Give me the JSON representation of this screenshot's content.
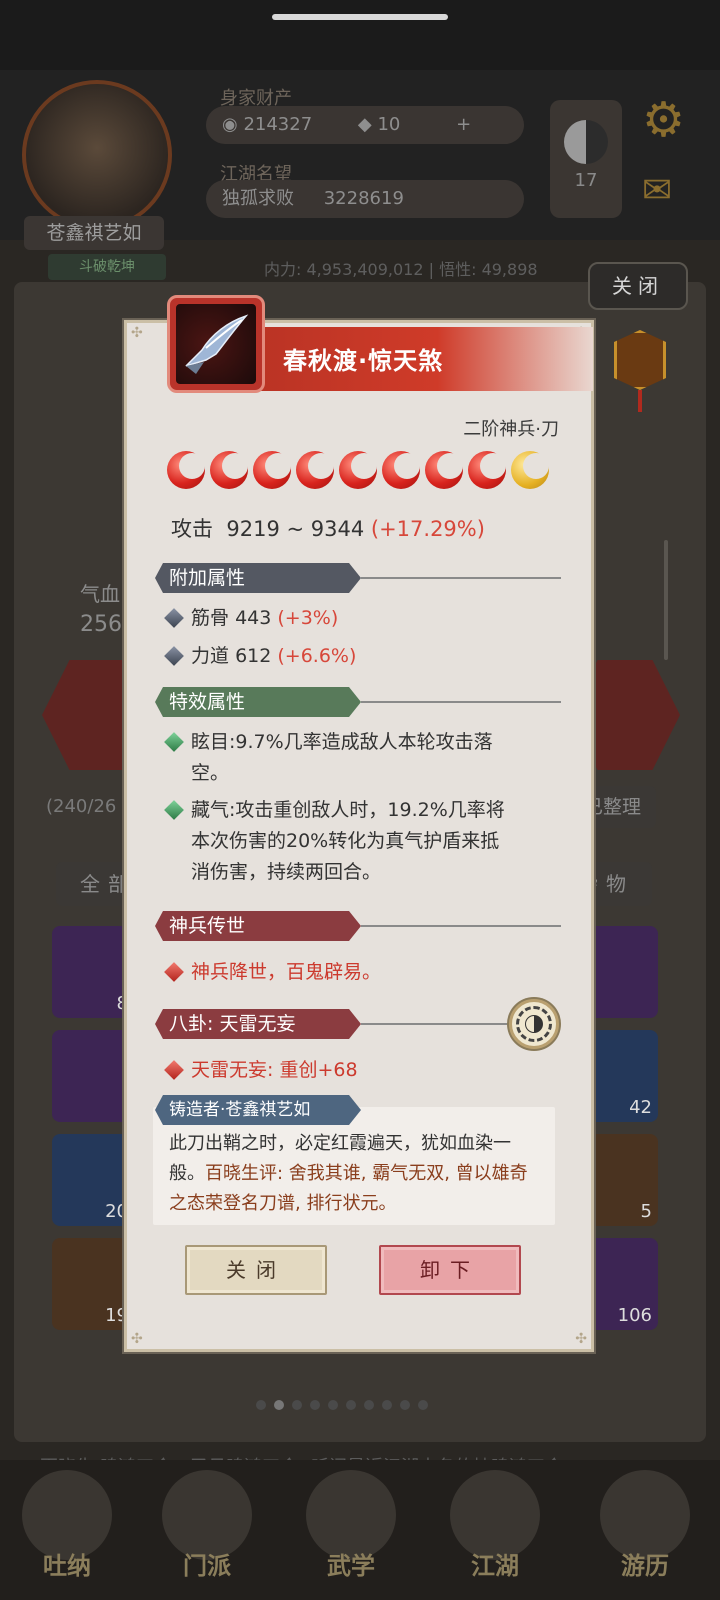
{
  "background": {
    "resource_label": "身家财产",
    "coins": "214327",
    "gems": "10",
    "fame_label": "江湖名望",
    "title_rank": "独孤求败",
    "fame_value": "3228619",
    "player_name": "苍鑫祺艺如",
    "player_sub": "斗破乾坤",
    "yinyang_count": "17",
    "stats_line": "内力: 4,953,409,012 | 悟性: 49,898",
    "top_close": "关闭",
    "tab_all": "全部",
    "tab_misc": "杂物",
    "sort_btn": "已整理",
    "capacity": "(240/26",
    "qixue_label": "气血",
    "qixue_value": "256",
    "cell_counts": [
      "8",
      "42",
      "20",
      "5",
      "19",
      "106"
    ],
    "news_line1": "百晓生:鸣鸿刀令，又见鸣鸿刀令! 听闻最近江湖中各的持鸣鸿刀令",
    "news_line2": "",
    "nav": [
      "吐纳",
      "门派",
      "武学",
      "江湖",
      "游历"
    ]
  },
  "modal": {
    "title": "春秋渡·惊天煞",
    "grade": "二阶神兵·刀",
    "stars": {
      "filled": 8,
      "half": 1
    },
    "attack_label": "攻击",
    "attack_range": "9219 ~ 9344",
    "attack_bonus": "(+17.29%)",
    "sections": {
      "extra_attrs_title": "附加属性",
      "extra_attrs": [
        {
          "name": "筋骨",
          "value": "443",
          "bonus": "(+3%)"
        },
        {
          "name": "力道",
          "value": "612",
          "bonus": "(+6.6%)"
        }
      ],
      "special_title": "特效属性",
      "special_1_line1": "眩目:9.7%几率造成敌人本轮攻击落",
      "special_1_line2": "空。",
      "special_2_line1": "藏气:攻击重创敌人时，19.2%几率将",
      "special_2_line2": "本次伤害的20%转化为真气护盾来抵",
      "special_2_line3": "消伤害，持续两回合。",
      "legacy_title": "神兵传世",
      "legacy_text": "神兵降世，百鬼辟易。",
      "bagua_title": "八卦: 天雷无妄",
      "bagua_text": "天雷无妄: 重创+68",
      "forger_title": "铸造者·苍鑫祺艺如",
      "forger_line1": "此刀出鞘之时，必定红霞遍天，犹如血染一",
      "forger_line2_a": "般。",
      "forger_line2_b": "百晓生评: 舍我其谁, 霸气无双, 曾以雄奇",
      "forger_line3": "之态荣登名刀谱, 排行状元。"
    },
    "buttons": {
      "close": "关闭",
      "unequip": "卸下"
    }
  },
  "colors": {
    "accent_red": "#cf3b29",
    "bonus_red": "#d7473a",
    "panel": "#e6e1dc"
  }
}
